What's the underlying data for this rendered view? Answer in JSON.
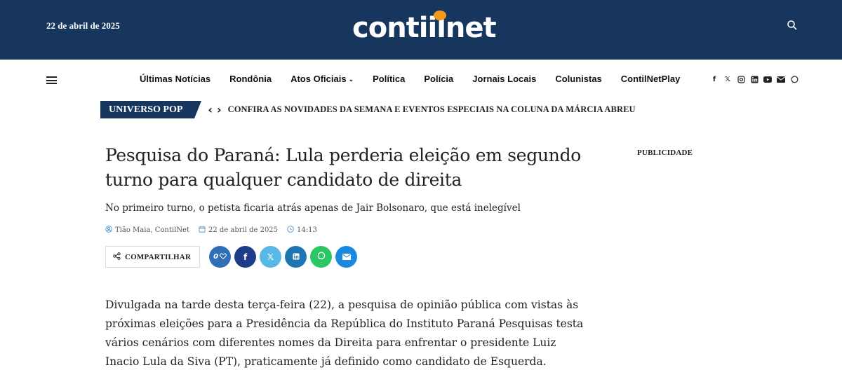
{
  "header": {
    "date": "22 de abril de 2025",
    "logo_text_a": "conti",
    "logo_text_b": "lnet"
  },
  "nav": {
    "items": [
      {
        "label": "Últimas Notícias"
      },
      {
        "label": "Rondônia"
      },
      {
        "label": "Atos Oficiais",
        "caret": "⌄"
      },
      {
        "label": "Política"
      },
      {
        "label": "Polícia"
      },
      {
        "label": "Jornais Locais"
      },
      {
        "label": "Colunistas"
      },
      {
        "label": "ContilNetPlay"
      }
    ],
    "social_icons": [
      "facebook-icon",
      "x-icon",
      "instagram-icon",
      "linkedin-icon",
      "youtube-icon",
      "email-icon",
      "whatsapp-icon"
    ]
  },
  "ticker": {
    "label": "UNIVERSO POP",
    "prev": "‹",
    "next": "›",
    "headline": "CONFIRA AS NOVIDADES DA SEMANA E EVENTOS ESPECIAIS NA COLUNA DA MÁRCIA ABREU"
  },
  "article": {
    "title": "Pesquisa do Paraná: Lula perderia eleição em segundo turno para qualquer candidato de direita",
    "subtitle": "No primeiro turno, o petista ficaria atrás apenas de Jair Bolsonaro, que está inelegível",
    "author": "Tião Maia, ContilNet",
    "date": "22 de abril de 2025",
    "time": "14:13",
    "share_label": "COMPARTILHAR",
    "like_count": "0",
    "body": "Divulgada na tarde desta terça-feira (22), a pesquisa de opinião pública com vistas às próximas eleições para a Presidência da República do Instituto Paraná Pesquisas testa vários cenários com diferentes nomes da Direita para enfrentar o presidente Luiz Inacio Lula da Siva (PT), praticamente já definido como candidato de Esquerda."
  },
  "sidebar": {
    "ad_label": "PUBLICIDADE"
  },
  "colors": {
    "brand_navy": "#17365e",
    "logo_accent": "#f39a1e",
    "facebook": "#1d3d8a",
    "twitter": "#5ab8e8",
    "linkedin": "#1d76b0",
    "whatsapp": "#2cc765",
    "email": "#1a8ae0"
  }
}
